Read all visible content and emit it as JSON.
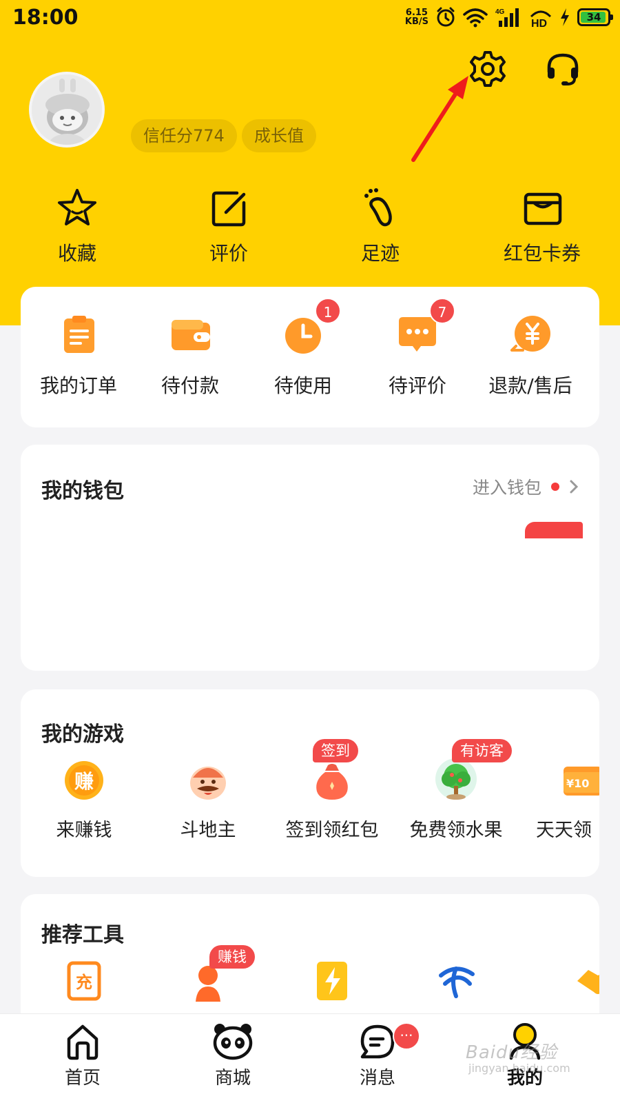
{
  "status_bar": {
    "time": "18:00",
    "net_speed_value": "6.15",
    "net_speed_unit": "KB/S",
    "signal_label": "4G",
    "hd_label": "HD",
    "battery": "34"
  },
  "profile": {
    "trust_score": "信任分774",
    "growth": "成长值"
  },
  "quick_actions": [
    {
      "label": "收藏",
      "icon": "star-icon"
    },
    {
      "label": "评价",
      "icon": "edit-icon"
    },
    {
      "label": "足迹",
      "icon": "footprint-icon"
    },
    {
      "label": "红包卡券",
      "icon": "wallet-card-icon"
    }
  ],
  "orders": [
    {
      "label": "我的订单",
      "icon": "order-list-icon"
    },
    {
      "label": "待付款",
      "icon": "wallet-icon"
    },
    {
      "label": "待使用",
      "icon": "clock-icon",
      "badge": "1"
    },
    {
      "label": "待评价",
      "icon": "chat-icon",
      "badge": "7"
    },
    {
      "label": "退款/售后",
      "icon": "refund-icon"
    }
  ],
  "wallet": {
    "title": "我的钱包",
    "link": "进入钱包"
  },
  "games": {
    "title": "我的游戏",
    "items": [
      {
        "label": "来赚钱",
        "icon": "coin-icon"
      },
      {
        "label": "斗地主",
        "icon": "landlord-icon"
      },
      {
        "label": "签到领红包",
        "icon": "money-bag-icon",
        "tag": "签到"
      },
      {
        "label": "免费领水果",
        "icon": "fruit-tree-icon",
        "tag": "有访客"
      },
      {
        "label": "天天领",
        "icon": "coupon-icon"
      }
    ]
  },
  "tools": {
    "title": "推荐工具",
    "items": [
      {
        "icon": "recharge-icon",
        "glyph": "充"
      },
      {
        "icon": "person-icon",
        "tag": "赚钱"
      },
      {
        "icon": "electricity-icon"
      },
      {
        "icon": "telecom-icon"
      },
      {
        "icon": "handshake-icon"
      }
    ]
  },
  "bottom_nav": [
    {
      "label": "首页",
      "icon": "home-icon"
    },
    {
      "label": "商城",
      "icon": "panda-icon"
    },
    {
      "label": "消息",
      "icon": "message-icon",
      "badge": "···"
    },
    {
      "label": "我的",
      "icon": "profile-icon",
      "active": true
    }
  ],
  "watermark": "Baidu经验",
  "watermark_sub": "jingyan.baidu.com"
}
